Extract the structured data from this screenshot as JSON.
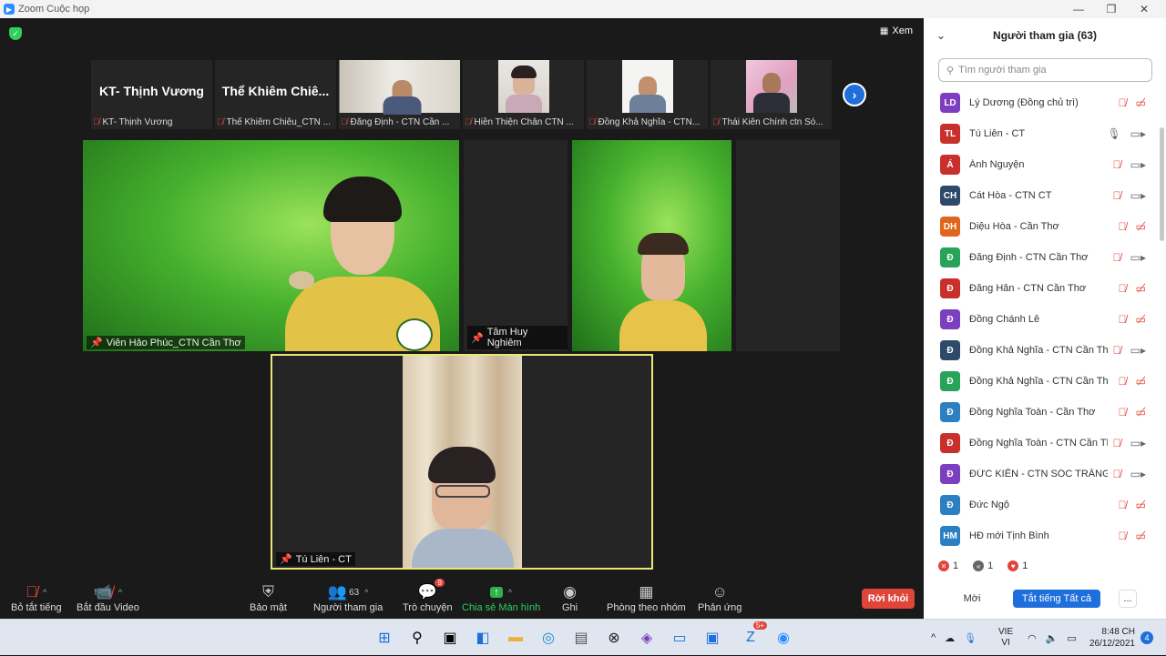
{
  "window": {
    "title": "Zoom Cuộc họp"
  },
  "meeting": {
    "view_label": "Xem",
    "strip": [
      {
        "big_name": "KT- Thịnh Vương",
        "label": "KT- Thịnh Vương",
        "video": false
      },
      {
        "big_name": "Thể Khiêm Chiê...",
        "label": "Thể Khiêm Chiêu_CTN ...",
        "video": false
      },
      {
        "big_name": "",
        "label": "Đăng Định - CTN Cần ...",
        "video": true
      },
      {
        "big_name": "",
        "label": "Hiền Thiện Chân CTN ...",
        "video": true
      },
      {
        "big_name": "",
        "label": "Đồng Khả Nghĩa - CTN...",
        "video": true
      },
      {
        "big_name": "",
        "label": "Thái Kiên Chính ctn Só...",
        "video": true
      }
    ],
    "tiles": [
      {
        "label": "Viên Hảo Phúc_CTN Cần Thơ"
      },
      {
        "label": "Tâm Huy Nghiêm"
      },
      {
        "label": "Tú Liên - CT"
      }
    ]
  },
  "toolbar": {
    "mute": "Bỏ tắt tiếng",
    "video": "Bắt đầu Video",
    "security": "Bảo mật",
    "participants": "Người tham gia",
    "participants_count": "63",
    "chat": "Trò chuyện",
    "chat_badge": "9",
    "share": "Chia sẻ Màn hình",
    "record": "Ghi",
    "breakout": "Phòng theo nhóm",
    "reactions": "Phản ứng",
    "leave": "Rời khỏi"
  },
  "panel": {
    "title": "Người tham gia (63)",
    "search_placeholder": "Tìm người tham gia",
    "participants": [
      {
        "initials": "LD",
        "color": "#7b3fbf",
        "name": "Lý Dương (Đồng chủ trì)",
        "mic": "off",
        "cam": "off"
      },
      {
        "initials": "TL",
        "color": "#c9302c",
        "name": "Tú Liên - CT",
        "mic": "on",
        "cam": "on"
      },
      {
        "initials": "Á",
        "color": "#c9302c",
        "name": "Ánh Nguyện",
        "mic": "off",
        "cam": "on"
      },
      {
        "initials": "CH",
        "color": "#2e4a6b",
        "name": "Cát Hòa - CTN CT",
        "mic": "off",
        "cam": "on"
      },
      {
        "initials": "DH",
        "color": "#e0661b",
        "name": "Diệu Hòa - Cần Thơ",
        "mic": "off",
        "cam": "off"
      },
      {
        "initials": "Đ",
        "color": "#27a35a",
        "name": "Đăng Định - CTN Cần Thơ",
        "mic": "off",
        "cam": "on"
      },
      {
        "initials": "Đ",
        "color": "#c9302c",
        "name": "Đăng Hân - CTN Cần Thơ",
        "mic": "off",
        "cam": "off"
      },
      {
        "initials": "Đ",
        "color": "#7b3fbf",
        "name": "Đồng Chánh Lễ",
        "mic": "off",
        "cam": "off"
      },
      {
        "initials": "Đ",
        "color": "#2e4a6b",
        "name": "Đồng Khả Nghĩa - CTN Cần Thơ",
        "mic": "off",
        "cam": "on"
      },
      {
        "initials": "Đ",
        "color": "#27a35a",
        "name": "Đồng Khả Nghĩa - CTN Cần Thơ (...",
        "mic": "off",
        "cam": "off"
      },
      {
        "initials": "Đ",
        "color": "#2c7fc1",
        "name": "Đồng Nghĩa Toàn - Cần Thơ",
        "mic": "off",
        "cam": "off"
      },
      {
        "initials": "Đ",
        "color": "#c9302c",
        "name": "Đồng Nghĩa Toàn - CTN Cần Thơ",
        "mic": "off",
        "cam": "on"
      },
      {
        "initials": "Đ",
        "color": "#7b3fbf",
        "name": "ĐỨC KIẾN - CTN SÓC TRĂNG",
        "mic": "off",
        "cam": "on"
      },
      {
        "initials": "Đ",
        "color": "#2c7fc1",
        "name": "Đức Ngộ",
        "mic": "off",
        "cam": "off"
      },
      {
        "initials": "HM",
        "color": "#2c7fc1",
        "name": "HĐ mới Tịnh Bình",
        "mic": "off",
        "cam": "off"
      }
    ],
    "reactions": [
      {
        "symbol": "✕",
        "count": "1",
        "color": "#e0453a"
      },
      {
        "symbol": "«",
        "count": "1",
        "color": "#666"
      },
      {
        "symbol": "♥",
        "count": "1",
        "color": "#e0453a"
      }
    ],
    "invite": "Mời",
    "mute_all": "Tắt tiếng Tất cả",
    "more": "..."
  },
  "taskbar": {
    "lang_top": "VIE",
    "lang_bottom": "VI",
    "time": "8:48 CH",
    "date": "26/12/2021",
    "notif_count": "4",
    "zalo_badge": "5+"
  }
}
